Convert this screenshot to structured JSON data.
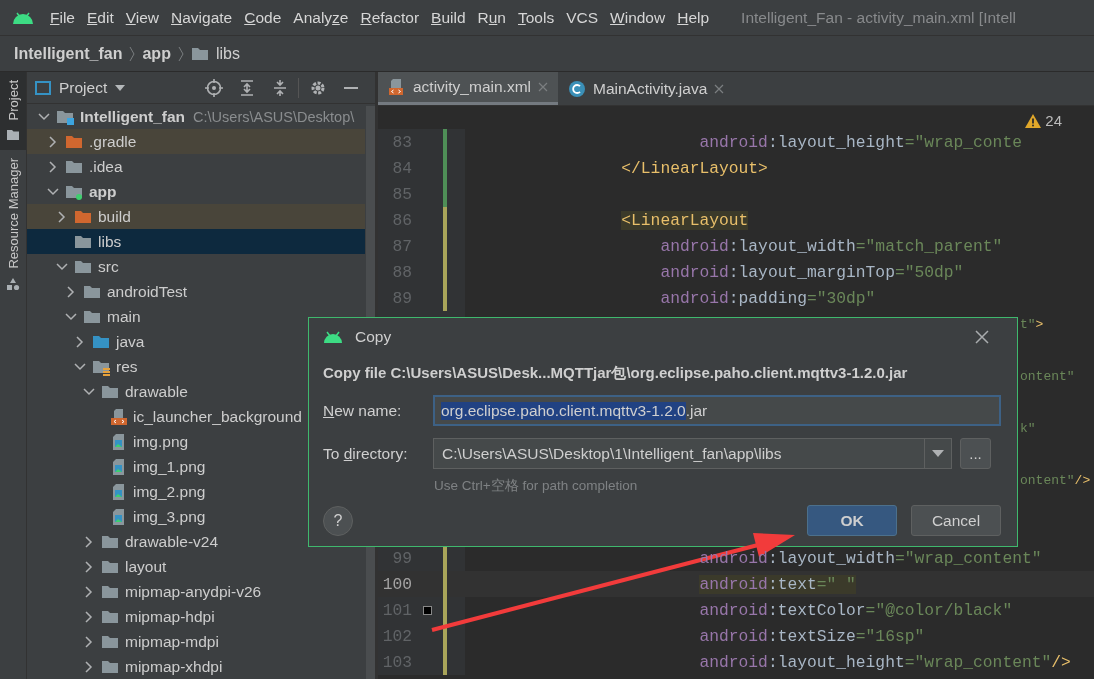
{
  "menu_bar": {
    "items": [
      {
        "key": "F",
        "after": "ile"
      },
      {
        "key": "E",
        "after": "dit"
      },
      {
        "key": "V",
        "after": "iew"
      },
      {
        "key": "N",
        "after": "avigate"
      },
      {
        "key": "C",
        "after": "ode"
      },
      {
        "before": "Analy",
        "key": "z",
        "after": "e"
      },
      {
        "key": "R",
        "after": "efactor"
      },
      {
        "key": "B",
        "after": "uild"
      },
      {
        "before": "R",
        "key": "u",
        "after": "n"
      },
      {
        "key": "T",
        "after": "ools"
      },
      {
        "before": "VCS"
      },
      {
        "key": "W",
        "after": "indow"
      },
      {
        "key": "H",
        "after": "elp"
      }
    ],
    "title": "Intelligent_Fan - activity_main.xml [Intell"
  },
  "breadcrumb": [
    {
      "label": "Intelligent_fan",
      "kind": "project"
    },
    {
      "label": "app",
      "kind": "module"
    },
    {
      "label": "libs",
      "kind": "folder"
    }
  ],
  "side_stripe": [
    {
      "label": "Project",
      "selected": true,
      "kind": "folder"
    },
    {
      "label": "Resource Manager",
      "selected": false,
      "kind": "shapes"
    }
  ],
  "project": {
    "view": "Project",
    "tree": [
      {
        "label": "Intelligent_fan",
        "path": "C:\\Users\\ASUS\\Desktop\\",
        "kind": "root",
        "expanded": true,
        "selected": false,
        "excluded": false,
        "children": [
          {
            "label": ".gradle",
            "kind": "folder",
            "expanded": false,
            "selected": false,
            "excluded": true
          },
          {
            "label": ".idea",
            "kind": "folder",
            "expanded": false,
            "selected": false,
            "excluded": false
          },
          {
            "label": "app",
            "kind": "module",
            "expanded": true,
            "selected": false,
            "excluded": false,
            "children": [
              {
                "label": "build",
                "kind": "folder",
                "expanded": false,
                "selected": false,
                "excluded": true
              },
              {
                "label": "libs",
                "kind": "folder",
                "selected": true,
                "excluded": false
              },
              {
                "label": "src",
                "kind": "folder",
                "expanded": true,
                "selected": false,
                "excluded": false,
                "children": [
                  {
                    "label": "androidTest",
                    "kind": "folder",
                    "expanded": false,
                    "selected": false,
                    "excluded": false
                  },
                  {
                    "label": "main",
                    "kind": "folder",
                    "expanded": true,
                    "selected": false,
                    "excluded": false,
                    "children": [
                      {
                        "label": "java",
                        "kind": "source",
                        "expanded": false,
                        "selected": false,
                        "excluded": false
                      },
                      {
                        "label": "res",
                        "kind": "resources",
                        "expanded": true,
                        "selected": false,
                        "excluded": false,
                        "children": [
                          {
                            "label": "drawable",
                            "kind": "folder",
                            "expanded": true,
                            "selected": false,
                            "excluded": false,
                            "children": [
                              {
                                "label": "ic_launcher_background",
                                "kind": "xml",
                                "selected": false,
                                "excluded": false
                              },
                              {
                                "label": "img.png",
                                "kind": "image",
                                "selected": false,
                                "excluded": false
                              },
                              {
                                "label": "img_1.png",
                                "kind": "image",
                                "selected": false,
                                "excluded": false
                              },
                              {
                                "label": "img_2.png",
                                "kind": "image",
                                "selected": false,
                                "excluded": false
                              },
                              {
                                "label": "img_3.png",
                                "kind": "image",
                                "selected": false,
                                "excluded": false
                              }
                            ]
                          },
                          {
                            "label": "drawable-v24",
                            "kind": "folder",
                            "expanded": false,
                            "selected": false,
                            "excluded": false
                          },
                          {
                            "label": "layout",
                            "kind": "folder",
                            "expanded": false,
                            "selected": false,
                            "excluded": false
                          },
                          {
                            "label": "mipmap-anydpi-v26",
                            "kind": "folder",
                            "expanded": false,
                            "selected": false,
                            "excluded": false
                          },
                          {
                            "label": "mipmap-hdpi",
                            "kind": "folder",
                            "expanded": false,
                            "selected": false,
                            "excluded": false
                          },
                          {
                            "label": "mipmap-mdpi",
                            "kind": "folder",
                            "expanded": false,
                            "selected": false,
                            "excluded": false
                          },
                          {
                            "label": "mipmap-xhdpi",
                            "kind": "folder",
                            "expanded": false,
                            "selected": false,
                            "excluded": false
                          }
                        ]
                      }
                    ]
                  }
                ]
              }
            ]
          }
        ]
      }
    ]
  },
  "editor": {
    "tabs": [
      {
        "label": "activity_main.xml",
        "kind": "xml",
        "selected": true
      },
      {
        "label": "MainActivity.java",
        "kind": "class",
        "selected": false
      }
    ],
    "warnings": "24",
    "lines": [
      {
        "kind": "inner-attribute",
        "number": "83",
        "color": "#4f8f57",
        "current": false,
        "highlighted": false,
        "bookmarked": false,
        "tokens": [
          {
            "kind": "ns",
            "text": "android"
          },
          {
            "kind": "plain",
            "text": ":layout_height"
          },
          {
            "kind": "value",
            "text": "=\"wrap_conte"
          }
        ]
      },
      {
        "kind": "tag",
        "number": "84",
        "color": "#4f8f57",
        "current": false,
        "highlighted": false,
        "bookmarked": false,
        "tokens": [
          {
            "kind": "tag",
            "text": "</LinearLayout>"
          }
        ]
      },
      {
        "kind": "blank",
        "number": "85",
        "color": "#4f8f57",
        "current": false,
        "bookmarked": false
      },
      {
        "kind": "tag",
        "number": "86",
        "color": "#a9a55a",
        "current": false,
        "highlighted": true,
        "bookmarked": false,
        "tokens": [
          {
            "kind": "tag",
            "text": "<LinearLayout"
          }
        ]
      },
      {
        "kind": "attribute",
        "number": "87",
        "color": "#a9a55a",
        "current": false,
        "highlighted": false,
        "bookmarked": false,
        "tokens": [
          {
            "kind": "ns",
            "text": "android"
          },
          {
            "kind": "plain",
            "text": ":layout_width"
          },
          {
            "kind": "value",
            "text": "=\"match_parent\""
          }
        ]
      },
      {
        "kind": "attribute",
        "number": "88",
        "color": "#a9a55a",
        "current": false,
        "highlighted": false,
        "bookmarked": false,
        "tokens": [
          {
            "kind": "ns",
            "text": "android"
          },
          {
            "kind": "plain",
            "text": ":layout_marginTop"
          },
          {
            "kind": "value",
            "text": "=\"50dp\""
          }
        ]
      },
      {
        "kind": "attribute",
        "number": "89",
        "color": "#a9a55a",
        "current": false,
        "highlighted": false,
        "bookmarked": false,
        "tokens": [
          {
            "kind": "ns",
            "text": "android"
          },
          {
            "kind": "plain",
            "text": ":padding"
          },
          {
            "kind": "value",
            "text": "=\"30dp\""
          }
        ]
      },
      {
        "kind": "tail",
        "tokens": [
          {
            "kind": "value",
            "text": "t\""
          },
          {
            "kind": "tag",
            "text": ">"
          }
        ]
      },
      {
        "kind": "covered"
      },
      {
        "kind": "tail",
        "tokens": [
          {
            "kind": "value",
            "text": "ontent\""
          }
        ]
      },
      {
        "kind": "covered"
      },
      {
        "kind": "tail",
        "tokens": [
          {
            "kind": "value",
            "text": "k\""
          }
        ]
      },
      {
        "kind": "covered"
      },
      {
        "kind": "tail",
        "tokens": [
          {
            "kind": "value",
            "text": "ontent\""
          },
          {
            "kind": "tag",
            "text": "/>"
          }
        ]
      },
      {
        "kind": "covered"
      },
      {
        "kind": "covered"
      },
      {
        "kind": "inner-attribute",
        "number": "99",
        "color": "#a9a55a",
        "current": false,
        "highlighted": false,
        "bookmarked": false,
        "tokens": [
          {
            "kind": "ns",
            "text": "android"
          },
          {
            "kind": "plain",
            "text": ":layout_width"
          },
          {
            "kind": "value",
            "text": "=\"wrap_content\""
          }
        ]
      },
      {
        "kind": "inner-attribute",
        "number": "100",
        "color": "#a9a55a",
        "current": true,
        "highlighted": true,
        "bookmarked": false,
        "tokens": [
          {
            "kind": "ns",
            "text": "android"
          },
          {
            "kind": "plain",
            "text": ":text"
          },
          {
            "kind": "value",
            "text": "=\" \""
          }
        ]
      },
      {
        "kind": "inner-attribute",
        "number": "101",
        "color": "#a9a55a",
        "current": false,
        "highlighted": false,
        "bookmarked": true,
        "tokens": [
          {
            "kind": "ns",
            "text": "android"
          },
          {
            "kind": "plain",
            "text": ":textColor"
          },
          {
            "kind": "value",
            "text": "=\"@color/black\""
          }
        ]
      },
      {
        "kind": "inner-attribute",
        "number": "102",
        "color": "#a9a55a",
        "current": false,
        "highlighted": false,
        "bookmarked": false,
        "tokens": [
          {
            "kind": "ns",
            "text": "android"
          },
          {
            "kind": "plain",
            "text": ":textSize"
          },
          {
            "kind": "value",
            "text": "=\"16sp\""
          }
        ]
      },
      {
        "kind": "inner-attribute",
        "number": "103",
        "color": "#a9a55a",
        "current": false,
        "highlighted": false,
        "bookmarked": false,
        "tokens": [
          {
            "kind": "ns",
            "text": "android"
          },
          {
            "kind": "plain",
            "text": ":layout_height"
          },
          {
            "kind": "value",
            "text": "=\"wrap_content\""
          },
          {
            "kind": "tag",
            "text": "/>"
          }
        ]
      }
    ]
  },
  "dialog": {
    "title": "Copy",
    "message": "Copy file C:\\Users\\ASUS\\Desk...MQTTjar包\\org.eclipse.paho.client.mqttv3-1.2.0.jar",
    "new_name": {
      "label": {
        "key": "N",
        "after": "ew name:"
      },
      "value_selected": "org.eclipse.paho.client.mqttv3-1.2.0",
      "value_rest": ".jar"
    },
    "to_directory": {
      "label": {
        "before": "To ",
        "key": "d",
        "after": "irectory:"
      },
      "value": "C:\\Users\\ASUS\\Desktop\\1\\Intelligent_fan\\app\\libs",
      "browse": "..."
    },
    "hint": "Use Ctrl+空格 for path completion",
    "help": "?",
    "buttons": [
      {
        "label": "OK",
        "default": true
      },
      {
        "label": "Cancel",
        "default": false
      }
    ]
  }
}
